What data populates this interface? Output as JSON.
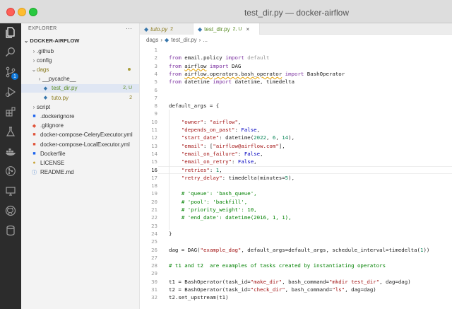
{
  "window": {
    "title": "test_dir.py — docker-airflow"
  },
  "activity": {
    "scm_badge": "1"
  },
  "sidebar": {
    "header": "EXPLORER",
    "more": "···",
    "root": "DOCKER-AIRFLOW",
    "items": [
      {
        "label": ".github",
        "chev": "›",
        "trail": "",
        "type": "folder"
      },
      {
        "label": "config",
        "chev": "›",
        "trail": "",
        "type": "folder"
      },
      {
        "label": "dags",
        "chev": "⌄",
        "trail": "",
        "type": "folder-mod"
      },
      {
        "label": "__pycache__",
        "chev": "›",
        "trail": "",
        "type": "folder"
      },
      {
        "label": "test_dir.py",
        "chev": "",
        "trail": "2, U",
        "type": "py-green"
      },
      {
        "label": "tuto.py",
        "chev": "",
        "trail": "2",
        "type": "py-olive"
      },
      {
        "label": "script",
        "chev": "›",
        "trail": "",
        "type": "folder"
      },
      {
        "label": ".dockerignore",
        "chev": "",
        "trail": "",
        "type": "docker"
      },
      {
        "label": ".gitignore",
        "chev": "",
        "trail": "",
        "type": "git"
      },
      {
        "label": "docker-compose-CeleryExecutor.yml",
        "chev": "",
        "trail": "",
        "type": "yml"
      },
      {
        "label": "docker-compose-LocalExecutor.yml",
        "chev": "",
        "trail": "",
        "type": "yml"
      },
      {
        "label": "Dockerfile",
        "chev": "",
        "trail": "",
        "type": "docker"
      },
      {
        "label": "LICENSE",
        "chev": "",
        "trail": "",
        "type": "license"
      },
      {
        "label": "README.md",
        "chev": "",
        "trail": "",
        "type": "info"
      }
    ]
  },
  "tabs": [
    {
      "name": "tuto.py",
      "status": "2"
    },
    {
      "name": "test_dir.py",
      "status": "2, U",
      "close": "×"
    }
  ],
  "breadcrumb": {
    "folder": "dags",
    "sep": "›",
    "file": "test_dir.py",
    "tail": "..."
  },
  "editor": {
    "active_line": 16,
    "lines": [
      {
        "n": "1",
        "t": []
      },
      {
        "n": "2",
        "t": [
          [
            "k",
            "from"
          ],
          [
            "m",
            " email.policy "
          ],
          [
            "k",
            "import"
          ],
          [
            "g",
            " default"
          ]
        ]
      },
      {
        "n": "3",
        "t": [
          [
            "k",
            "from"
          ],
          [
            "m",
            " "
          ],
          [
            "u",
            "airflow"
          ],
          [
            "m",
            " "
          ],
          [
            "k",
            "import"
          ],
          [
            "m",
            " DAG"
          ]
        ]
      },
      {
        "n": "4",
        "t": [
          [
            "k",
            "from"
          ],
          [
            "m",
            " "
          ],
          [
            "u",
            "airflow.operators.bash_operator"
          ],
          [
            "m",
            " "
          ],
          [
            "k",
            "import"
          ],
          [
            "m",
            " BashOperator"
          ]
        ]
      },
      {
        "n": "5",
        "t": [
          [
            "k",
            "from"
          ],
          [
            "m",
            " datetime "
          ],
          [
            "k",
            "import"
          ],
          [
            "m",
            " datetime, timedelta"
          ]
        ]
      },
      {
        "n": "6",
        "t": []
      },
      {
        "n": "7",
        "t": []
      },
      {
        "n": "8",
        "t": [
          [
            "m",
            "default_args = {"
          ]
        ]
      },
      {
        "n": "9",
        "t": []
      },
      {
        "n": "10",
        "t": [
          [
            "m",
            "    "
          ],
          [
            "s",
            "\"owner\""
          ],
          [
            "m",
            ": "
          ],
          [
            "s",
            "\"airflow\""
          ],
          [
            "m",
            ","
          ]
        ]
      },
      {
        "n": "11",
        "t": [
          [
            "m",
            "    "
          ],
          [
            "s",
            "\"depends_on_past\""
          ],
          [
            "m",
            ": "
          ],
          [
            "kb",
            "False"
          ],
          [
            "m",
            ","
          ]
        ]
      },
      {
        "n": "12",
        "t": [
          [
            "m",
            "    "
          ],
          [
            "s",
            "\"start_date\""
          ],
          [
            "m",
            ": datetime("
          ],
          [
            "n",
            "2022"
          ],
          [
            "m",
            ", "
          ],
          [
            "n",
            "6"
          ],
          [
            "m",
            ", "
          ],
          [
            "n",
            "14"
          ],
          [
            "m",
            "),"
          ]
        ]
      },
      {
        "n": "13",
        "t": [
          [
            "m",
            "    "
          ],
          [
            "s",
            "\"email\""
          ],
          [
            "m",
            ": ["
          ],
          [
            "s",
            "\"airflow@airflow.com\""
          ],
          [
            "m",
            "],"
          ]
        ]
      },
      {
        "n": "14",
        "t": [
          [
            "m",
            "    "
          ],
          [
            "s",
            "\"email_on_failure\""
          ],
          [
            "m",
            ": "
          ],
          [
            "kb",
            "False"
          ],
          [
            "m",
            ","
          ]
        ]
      },
      {
        "n": "15",
        "t": [
          [
            "m",
            "    "
          ],
          [
            "s",
            "\"email_on_retry\""
          ],
          [
            "m",
            ": "
          ],
          [
            "kb",
            "False"
          ],
          [
            "m",
            ","
          ]
        ]
      },
      {
        "n": "16",
        "t": [
          [
            "m",
            "    "
          ],
          [
            "s",
            "\"retries\""
          ],
          [
            "m",
            ": "
          ],
          [
            "n",
            "1"
          ],
          [
            "m",
            ","
          ]
        ]
      },
      {
        "n": "17",
        "t": [
          [
            "m",
            "    "
          ],
          [
            "s",
            "\"retry_delay\""
          ],
          [
            "m",
            ": timedelta(minutes="
          ],
          [
            "n",
            "5"
          ],
          [
            "m",
            "),"
          ]
        ]
      },
      {
        "n": "18",
        "t": []
      },
      {
        "n": "19",
        "t": [
          [
            "m",
            "    "
          ],
          [
            "c",
            "# 'queue': 'bash_queue',"
          ]
        ]
      },
      {
        "n": "20",
        "t": [
          [
            "m",
            "    "
          ],
          [
            "c",
            "# 'pool': 'backfill',"
          ]
        ]
      },
      {
        "n": "21",
        "t": [
          [
            "m",
            "    "
          ],
          [
            "c",
            "# 'priority_weight': 10,"
          ]
        ]
      },
      {
        "n": "22",
        "t": [
          [
            "m",
            "    "
          ],
          [
            "c",
            "# 'end_date': datetime(2016, 1, 1),"
          ]
        ]
      },
      {
        "n": "23",
        "t": []
      },
      {
        "n": "24",
        "t": [
          [
            "m",
            "}"
          ]
        ]
      },
      {
        "n": "25",
        "t": []
      },
      {
        "n": "26",
        "t": [
          [
            "m",
            "dag = DAG("
          ],
          [
            "s",
            "\"example_dag\""
          ],
          [
            "m",
            ", default_args=default_args, schedule_interval=timedelta("
          ],
          [
            "n",
            "1"
          ],
          [
            "m",
            "))"
          ]
        ]
      },
      {
        "n": "27",
        "t": []
      },
      {
        "n": "28",
        "t": [
          [
            "c",
            "# t1 and t2  are examples of tasks created by instantiating operators"
          ]
        ]
      },
      {
        "n": "29",
        "t": []
      },
      {
        "n": "30",
        "t": [
          [
            "m",
            "t1 = BashOperator(task_id="
          ],
          [
            "s",
            "\"make_dir\""
          ],
          [
            "m",
            ", bash_command="
          ],
          [
            "s",
            "\"mkdir test_dir\""
          ],
          [
            "m",
            ", dag=dag)"
          ]
        ]
      },
      {
        "n": "31",
        "t": [
          [
            "m",
            "t2 = BashOperator(task_id="
          ],
          [
            "s",
            "\"check_dir\""
          ],
          [
            "m",
            ", bash_command="
          ],
          [
            "s",
            "\"ls\""
          ],
          [
            "m",
            ", dag=dag)"
          ]
        ]
      },
      {
        "n": "32",
        "t": [
          [
            "m",
            "t2.set_upstream(t1)"
          ]
        ]
      }
    ]
  },
  "colors": {
    "activity_bg": "#2c2c2c",
    "sidebar_bg": "#f3f3f3",
    "accent": "#0b74d6",
    "modified_green": "#5a8c25",
    "modified_olive": "#8a7a1d"
  }
}
